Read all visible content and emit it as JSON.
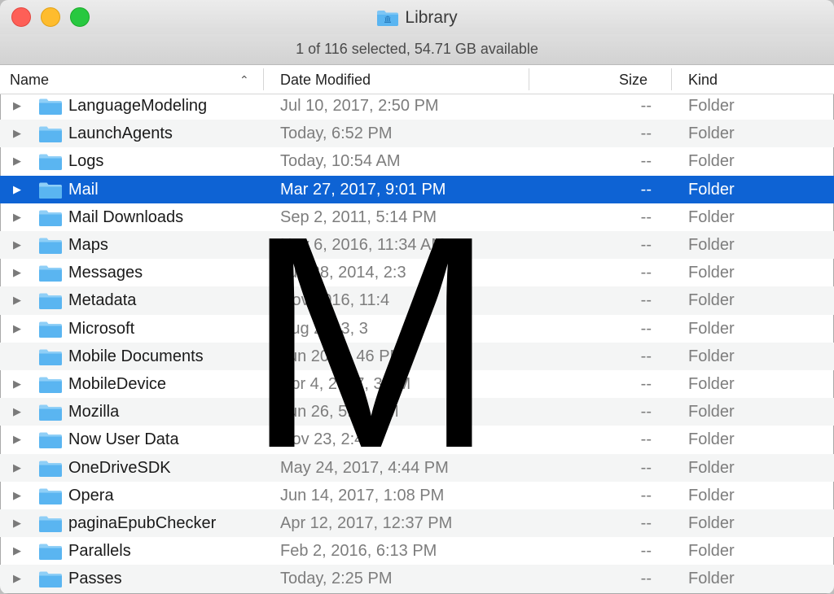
{
  "window": {
    "title": "Library",
    "title_icon": "library-folder-icon"
  },
  "status": {
    "text": "1 of 116 selected, 54.71 GB available"
  },
  "columns": {
    "name": "Name",
    "date": "Date Modified",
    "size": "Size",
    "kind": "Kind",
    "sort_icon": "chevron-up-icon"
  },
  "colors": {
    "selection": "#0e63d4",
    "folder": "#5ab5f1",
    "close": "#fe5f57",
    "minimize": "#febc2e",
    "maximize": "#28c840"
  },
  "overlay": {
    "letter": "M"
  },
  "rows": [
    {
      "name": "LanguageModeling",
      "date": "Jul 10, 2017, 2:50 PM",
      "size": "--",
      "kind": "Folder",
      "expandable": true
    },
    {
      "name": "LaunchAgents",
      "date": "Today, 6:52 PM",
      "size": "--",
      "kind": "Folder",
      "expandable": true
    },
    {
      "name": "Logs",
      "date": "Today, 10:54 AM",
      "size": "--",
      "kind": "Folder",
      "expandable": true
    },
    {
      "name": "Mail",
      "date": "Mar 27, 2017, 9:01 PM",
      "size": "--",
      "kind": "Folder",
      "expandable": true,
      "selected": true
    },
    {
      "name": "Mail Downloads",
      "date": "Sep 2, 2011, 5:14 PM",
      "size": "--",
      "kind": "Folder",
      "expandable": true
    },
    {
      "name": "Maps",
      "date": "Nov 6, 2016, 11:34 AM",
      "size": "--",
      "kind": "Folder",
      "expandable": true
    },
    {
      "name": "Messages",
      "date": "Jun 28, 2014, 2:3",
      "size": "--",
      "kind": "Folder",
      "expandable": true
    },
    {
      "name": "Metadata",
      "date": "Nov 2016, 11:4",
      "size": "--",
      "kind": "Folder",
      "expandable": true
    },
    {
      "name": "Microsoft",
      "date": "Aug 2013, 3",
      "size": "--",
      "kind": "Folder",
      "expandable": true
    },
    {
      "name": "Mobile Documents",
      "date": "Jun 2017, 46 PM",
      "size": "--",
      "kind": "Folder",
      "expandable": false
    },
    {
      "name": "MobileDevice",
      "date": "Apr 4, 2017, 3 AM",
      "size": "--",
      "kind": "Folder",
      "expandable": true
    },
    {
      "name": "Mozilla",
      "date": "Jun 26, 5:25 PM",
      "size": "--",
      "kind": "Folder",
      "expandable": true
    },
    {
      "name": "Now User Data",
      "date": "Nov 23, 2:40",
      "size": "--",
      "kind": "Folder",
      "expandable": true
    },
    {
      "name": "OneDriveSDK",
      "date": "May 24, 2017, 4:44 PM",
      "size": "--",
      "kind": "Folder",
      "expandable": true
    },
    {
      "name": "Opera",
      "date": "Jun 14, 2017, 1:08 PM",
      "size": "--",
      "kind": "Folder",
      "expandable": true
    },
    {
      "name": "paginaEpubChecker",
      "date": "Apr 12, 2017, 12:37 PM",
      "size": "--",
      "kind": "Folder",
      "expandable": true
    },
    {
      "name": "Parallels",
      "date": "Feb 2, 2016, 6:13 PM",
      "size": "--",
      "kind": "Folder",
      "expandable": true
    },
    {
      "name": "Passes",
      "date": "Today, 2:25 PM",
      "size": "--",
      "kind": "Folder",
      "expandable": true
    }
  ]
}
